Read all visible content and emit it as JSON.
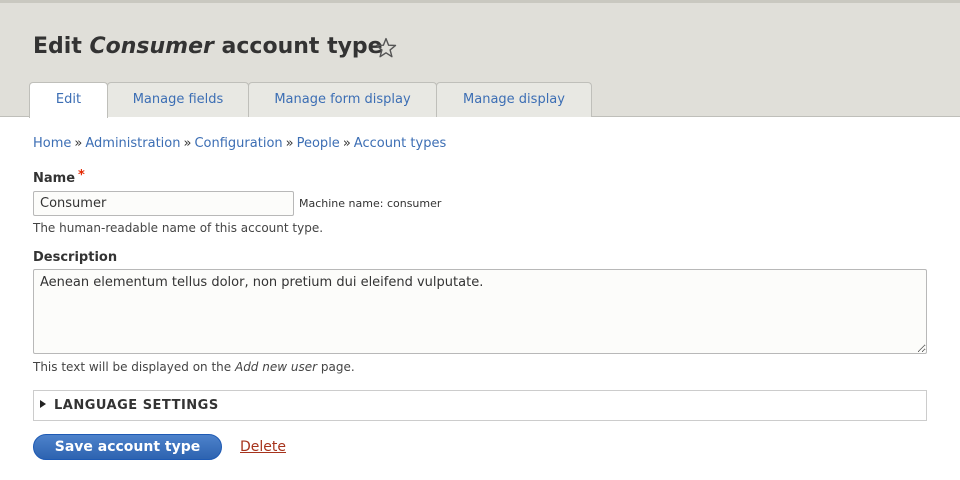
{
  "header": {
    "title_prefix": "Edit ",
    "title_em": "Consumer",
    "title_suffix": " account type",
    "star_icon": "star-outline-icon"
  },
  "tabs": [
    {
      "label": "Edit",
      "active": true
    },
    {
      "label": "Manage fields",
      "active": false
    },
    {
      "label": "Manage form display",
      "active": false
    },
    {
      "label": "Manage display",
      "active": false
    }
  ],
  "breadcrumb": {
    "items": [
      "Home",
      "Administration",
      "Configuration",
      "People",
      "Account types"
    ],
    "separator": "»"
  },
  "form": {
    "name_label": "Name",
    "required_marker": "*",
    "name_value": "Consumer",
    "machine_name": "Machine name: consumer",
    "name_help": "The human-readable name of this account type.",
    "description_label": "Description",
    "description_value": "Aenean elementum tellus dolor, non pretium dui eleifend vulputate.",
    "description_help_prefix": "This text will be displayed on the ",
    "description_help_em": "Add new user",
    "description_help_suffix": " page.",
    "language_settings": "LANGUAGE SETTINGS"
  },
  "actions": {
    "save_label": "Save account type",
    "delete_label": "Delete"
  },
  "colors": {
    "link": "#3c6eb4",
    "header_bg": "#e0dfd9",
    "button_blue": "#2d63b0",
    "required": "#e32700",
    "delete": "#a6331c"
  }
}
